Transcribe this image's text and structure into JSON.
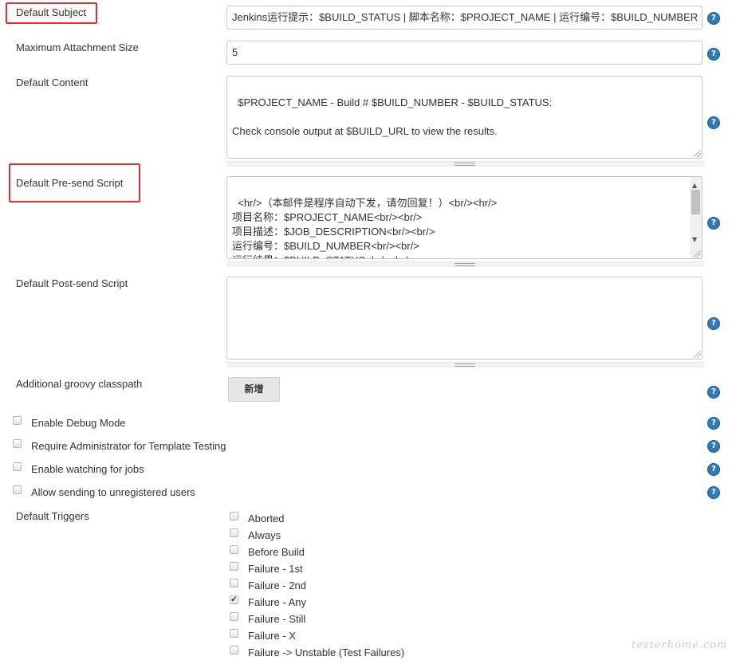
{
  "labels": {
    "default_subject": "Default Subject",
    "max_attachment": "Maximum Attachment Size",
    "default_content": "Default Content",
    "pre_send_script": "Default Pre-send Script",
    "post_send_script": "Default Post-send Script",
    "groovy_classpath": "Additional groovy classpath",
    "default_triggers": "Default Triggers"
  },
  "fields": {
    "subject_value": "Jenkins运行提示：$BUILD_STATUS | 脚本名称：$PROJECT_NAME | 运行编号：$BUILD_NUMBER",
    "max_attachment_value": "5",
    "content_value": "$PROJECT_NAME - Build # $BUILD_NUMBER - $BUILD_STATUS:\n\nCheck console output at $BUILD_URL to view the results.",
    "pre_send_value": "<hr/>（本邮件是程序自动下发，请勿回复！）<br/><hr/>\n项目名称：$PROJECT_NAME<br/><br/>\n项目描述：$JOB_DESCRIPTION<br/><br/>\n运行编号：$BUILD_NUMBER<br/><br/>\n运行结果：$BUILD_STATUS<br/><br/>\n触发原因：${CAUSE}<br/><br/>",
    "post_send_value": ""
  },
  "buttons": {
    "add_label": "新增"
  },
  "options": [
    {
      "label": "Enable Debug Mode",
      "checked": false
    },
    {
      "label": "Require Administrator for Template Testing",
      "checked": false
    },
    {
      "label": "Enable watching for jobs",
      "checked": false
    },
    {
      "label": "Allow sending to unregistered users",
      "checked": false
    }
  ],
  "triggers": [
    {
      "label": "Aborted",
      "checked": false
    },
    {
      "label": "Always",
      "checked": false
    },
    {
      "label": "Before Build",
      "checked": false
    },
    {
      "label": "Failure - 1st",
      "checked": false
    },
    {
      "label": "Failure - 2nd",
      "checked": false
    },
    {
      "label": "Failure - Any",
      "checked": true
    },
    {
      "label": "Failure - Still",
      "checked": false
    },
    {
      "label": "Failure - X",
      "checked": false
    },
    {
      "label": "Failure -> Unstable (Test Failures)",
      "checked": false
    }
  ],
  "icons": {
    "help": "help-icon",
    "checkmark": "✔"
  },
  "colors": {
    "highlight": "#e0302c",
    "help_icon": "#2f7ab8"
  },
  "help_glyph": "?",
  "watermark": "testerhome.com"
}
